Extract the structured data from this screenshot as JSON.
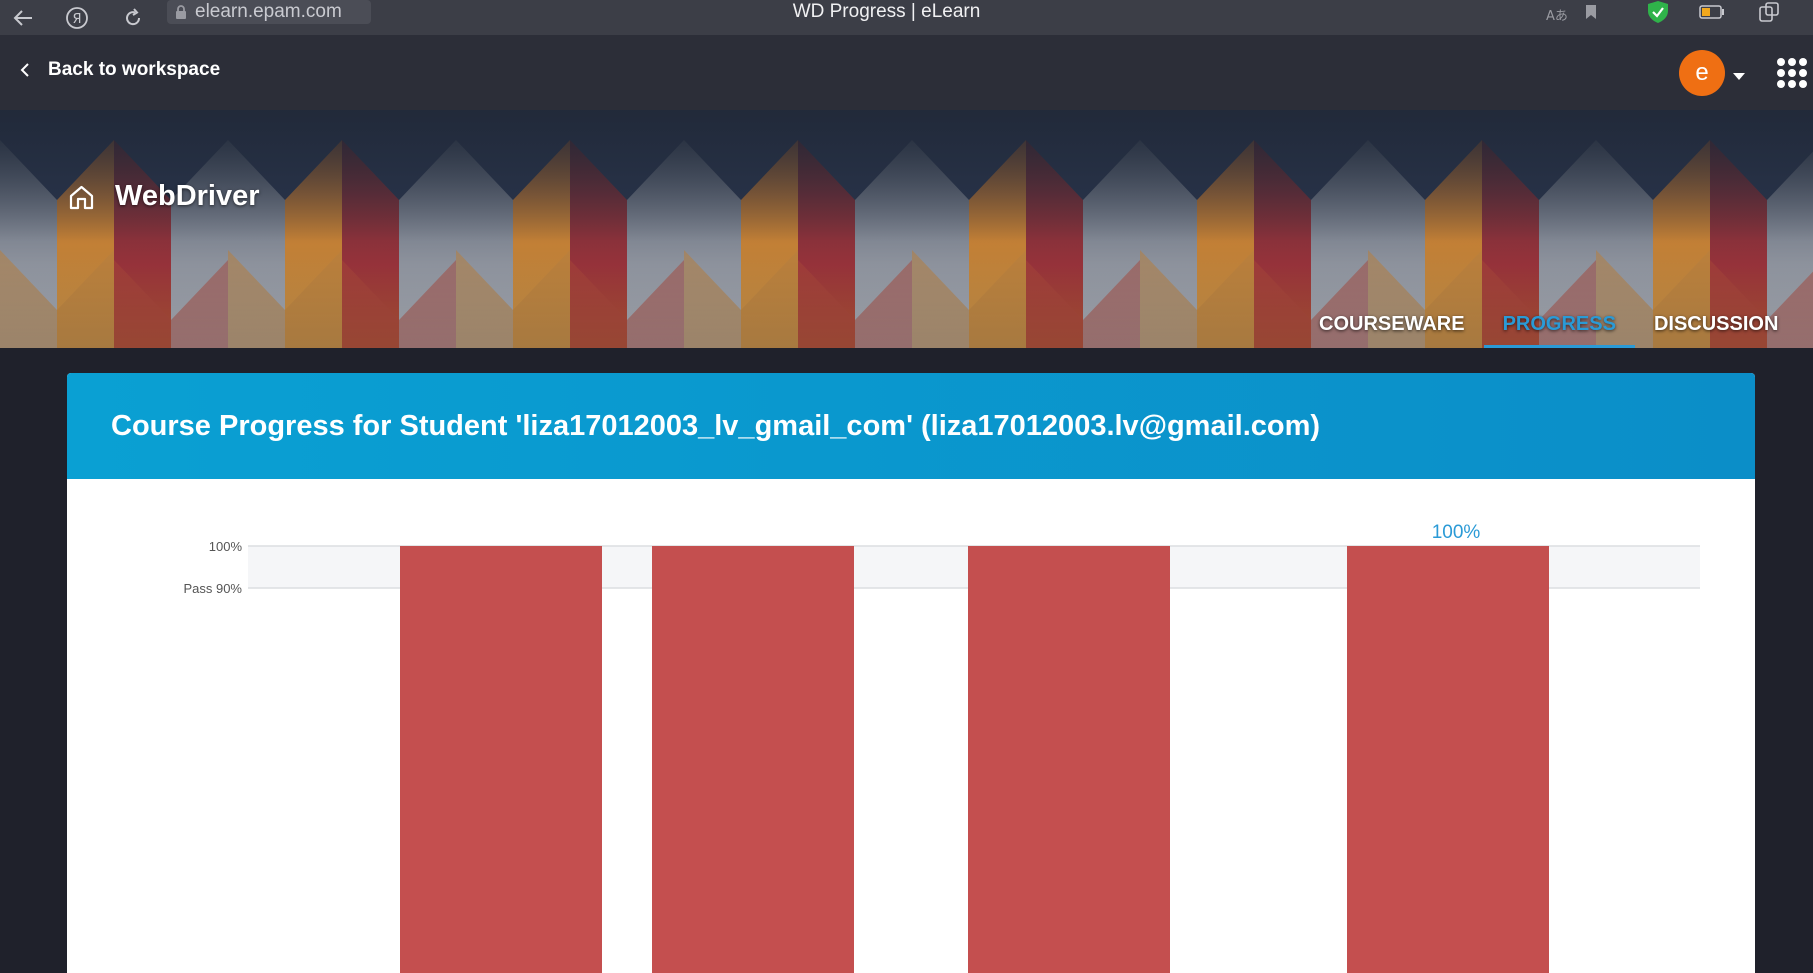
{
  "browser": {
    "url": "elearn.epam.com",
    "window_title": "WD Progress | eLearn",
    "icons": [
      "back-arrow-icon",
      "yandex-icon",
      "reload-icon",
      "lock-icon",
      "translate-icon",
      "bookmark-icon",
      "shield-icon",
      "battery-icon",
      "extensions-icon"
    ]
  },
  "header": {
    "back_label": "Back to workspace",
    "avatar_letter": "e",
    "colors": {
      "avatar": "#ef6f13",
      "bar": "#2c2e38"
    }
  },
  "course": {
    "title": "WebDriver",
    "tabs": [
      {
        "label": "COURSEWARE",
        "active": false
      },
      {
        "label": "PROGRESS",
        "active": true
      },
      {
        "label": "DISCUSSION",
        "active": false
      }
    ]
  },
  "progress": {
    "heading": "Course Progress for Student 'liza17012003_lv_gmail_com' (liza17012003.lv@gmail.com)",
    "colors": {
      "header": "#0b96cc",
      "bar": "#c44f4f",
      "accent": "#2a9ad6"
    }
  },
  "chart_data": {
    "type": "bar",
    "ylim": [
      0,
      100
    ],
    "values": [
      100,
      100,
      100,
      100
    ],
    "tick_labels": [
      "100%",
      "Pass 90%"
    ],
    "tick_values": [
      100,
      90
    ],
    "data_labels": [
      "",
      "",
      "",
      "100%"
    ],
    "grid": true
  }
}
